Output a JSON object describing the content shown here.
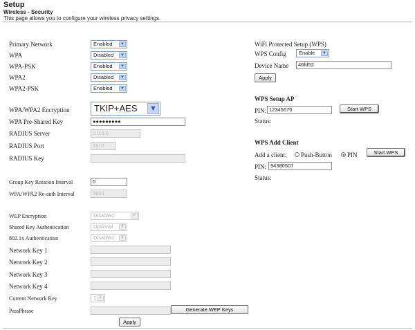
{
  "header": {
    "title": "Setup",
    "subtitle": "Wireless - Security",
    "description": "This page allows you to configure your wireless privacy settings."
  },
  "left": {
    "primary_network": {
      "label": "Primary Network",
      "value": "Enabled"
    },
    "wpa": {
      "label": "WPA",
      "value": "Disabled"
    },
    "wpa_psk": {
      "label": "WPA-PSK",
      "value": "Enabled"
    },
    "wpa2": {
      "label": "WPA2",
      "value": "Disabled"
    },
    "wpa2_psk": {
      "label": "WPA2-PSK",
      "value": "Enabled"
    },
    "encryption": {
      "label": "WPA/WPA2 Encryption",
      "value": "TKIP+AES"
    },
    "pre_shared_key": {
      "label": "WPA Pre-Shared Key",
      "value": "●●●●●●●●●"
    },
    "radius_server": {
      "label": "RADIUS Server",
      "value": "0.0.0.0"
    },
    "radius_port": {
      "label": "RADIUS Port",
      "value": "1812"
    },
    "radius_key": {
      "label": "RADIUS Key",
      "value": ""
    },
    "group_key_interval": {
      "label": "Group Key Rotation Interval",
      "value": "0"
    },
    "reauth_interval": {
      "label": "WPA/WPA2 Re-auth Interval",
      "value": "3600"
    },
    "wep_encryption": {
      "label": "WEP Encryption",
      "value": "Disabled"
    },
    "shared_key_auth": {
      "label": "Shared Key Authentication",
      "value": "Optional"
    },
    "auth_8021x": {
      "label": "802.1x Authentication",
      "value": "Disabled"
    },
    "network_key_1": {
      "label": "Network Key 1",
      "value": ""
    },
    "network_key_2": {
      "label": "Network Key 2",
      "value": ""
    },
    "network_key_3": {
      "label": "Network Key 3",
      "value": ""
    },
    "network_key_4": {
      "label": "Network Key 4",
      "value": ""
    },
    "current_network_key": {
      "label": "Current Network Key",
      "value": "1"
    },
    "passphrase": {
      "label": "PassPhrase",
      "value": ""
    },
    "generate_wep_label": "Generate WEP Keys",
    "apply_label": "Apply"
  },
  "right": {
    "wps_title": "WiFi Protected Setup (WPS)",
    "wps_config": {
      "label": "WPS Config",
      "value": "Enable"
    },
    "device_name": {
      "label": "Device Name",
      "value": "46fd52"
    },
    "apply_label": "Apply",
    "setup_ap": {
      "title": "WPS Setup AP",
      "pin_label": "PIN:",
      "pin_value": "12345670",
      "start_label": "Start WPS",
      "status_label": "Status:"
    },
    "add_client": {
      "title": "WPS Add Client",
      "add_label": "Add a client:",
      "push_label": "Push-Button",
      "pin_option_label": "PIN",
      "start_label": "Start WPS",
      "pin_label": "PIN:",
      "pin_value": "94380507",
      "status_label": "Status:"
    }
  }
}
